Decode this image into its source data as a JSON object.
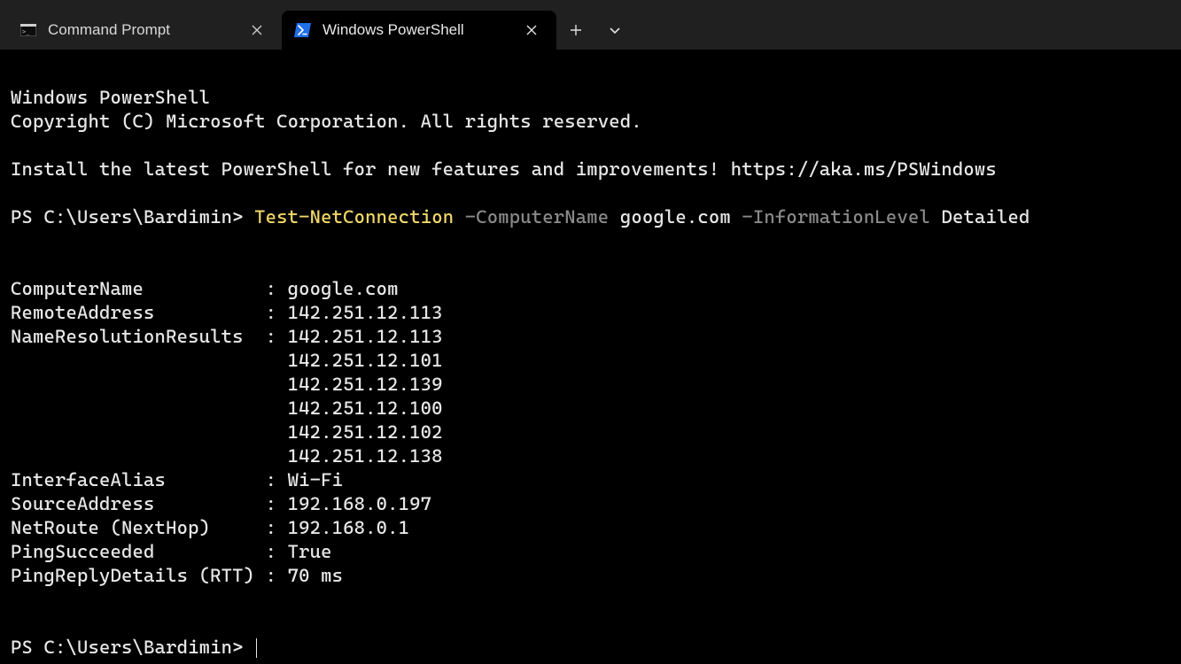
{
  "tabs": [
    {
      "label": "Command Prompt",
      "active": false
    },
    {
      "label": "Windows PowerShell",
      "active": true
    }
  ],
  "banner": {
    "line1": "Windows PowerShell",
    "line2": "Copyright (C) Microsoft Corporation. All rights reserved.",
    "line3": "Install the latest PowerShell for new features and improvements! https://aka.ms/PSWindows"
  },
  "prompt": {
    "ps": "PS C:\\Users\\Bardimin>",
    "cmd": "Test-NetConnection",
    "p1flag": "-ComputerName",
    "p1val": "google.com",
    "p2flag": "-InformationLevel",
    "p2val": "Detailed"
  },
  "output": {
    "ComputerName": "google.com",
    "RemoteAddress": "142.251.12.113",
    "NameResolutionResults": [
      "142.251.12.113",
      "142.251.12.101",
      "142.251.12.139",
      "142.251.12.100",
      "142.251.12.102",
      "142.251.12.138"
    ],
    "InterfaceAlias": "Wi-Fi",
    "SourceAddress": "192.168.0.197",
    "NetRoute_NextHop": "192.168.0.1",
    "PingSucceeded": "True",
    "PingReplyDetails_RTT": "70 ms"
  },
  "labels": {
    "ComputerName": "ComputerName",
    "RemoteAddress": "RemoteAddress",
    "NameResolutionResults": "NameResolutionResults",
    "InterfaceAlias": "InterfaceAlias",
    "SourceAddress": "SourceAddress",
    "NetRoute": "NetRoute (NextHop)",
    "PingSucceeded": "PingSucceeded",
    "PingReplyDetails": "PingReplyDetails (RTT)"
  },
  "prompt2": "PS C:\\Users\\Bardimin>"
}
